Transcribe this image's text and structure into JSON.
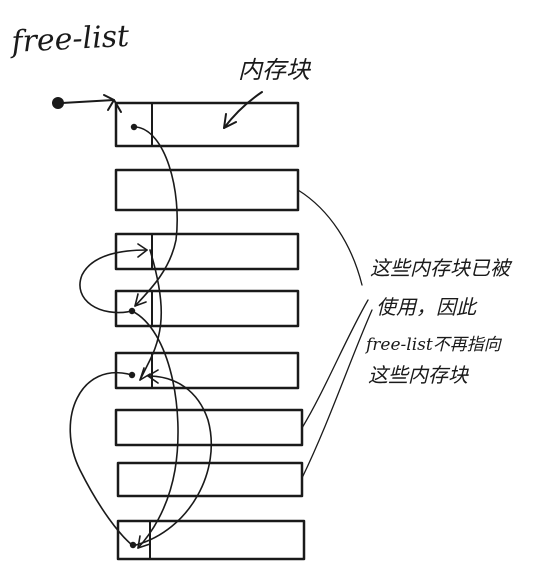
{
  "title": "free-list",
  "block_label": "内存块",
  "note_lines": [
    "这些内存块已被",
    "使用，因此",
    "free-list不再指向",
    "这些内存块"
  ],
  "blocks": [
    {
      "id": 1,
      "state": "free",
      "has_pointer_cell": true
    },
    {
      "id": 2,
      "state": "used",
      "has_pointer_cell": false
    },
    {
      "id": 3,
      "state": "free",
      "has_pointer_cell": true
    },
    {
      "id": 4,
      "state": "free",
      "has_pointer_cell": true
    },
    {
      "id": 5,
      "state": "free",
      "has_pointer_cell": true
    },
    {
      "id": 6,
      "state": "used",
      "has_pointer_cell": false
    },
    {
      "id": 7,
      "state": "used",
      "has_pointer_cell": false
    },
    {
      "id": 8,
      "state": "free",
      "has_pointer_cell": true
    }
  ],
  "ink_color": "#1a1a1a"
}
